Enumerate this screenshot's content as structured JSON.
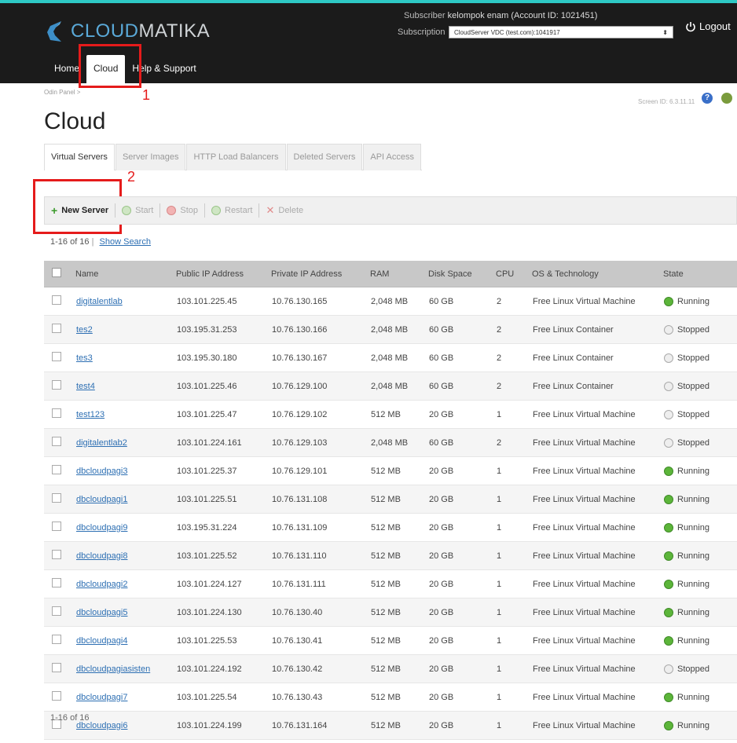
{
  "brand": {
    "part1": "CLOUD",
    "part2": "MATIKA"
  },
  "subscriber": {
    "label": "Subscriber",
    "value": "kelompok enam (Account ID: 1021451)"
  },
  "subscription": {
    "label": "Subscription",
    "value": "CloudServer VDC (test.com):1041917"
  },
  "logout": "Logout",
  "nav": [
    "Home",
    "Cloud",
    "Help & Support"
  ],
  "annotations": [
    "1",
    "2"
  ],
  "breadcrumb": "Odin Panel >",
  "screen_id": "Screen ID: 6.3.11.11",
  "help_glyph": "?",
  "page_title": "Cloud",
  "tabs": [
    "Virtual Servers",
    "Server Images",
    "HTTP Load Balancers",
    "Deleted Servers",
    "API Access"
  ],
  "toolbar": {
    "new": "New Server",
    "start": "Start",
    "stop": "Stop",
    "restart": "Restart",
    "delete": "Delete"
  },
  "count_top": {
    "text": "1-16 of 16",
    "link": "Show Search"
  },
  "columns": [
    "Name",
    "Public IP Address",
    "Private IP Address",
    "RAM",
    "Disk Space",
    "CPU",
    "OS & Technology",
    "State"
  ],
  "rows": [
    [
      "digitalentlab",
      "103.101.225.45",
      "10.76.130.165",
      "2,048 MB",
      "60 GB",
      "2",
      "Free Linux Virtual Machine",
      "Running"
    ],
    [
      "tes2",
      "103.195.31.253",
      "10.76.130.166",
      "2,048 MB",
      "60 GB",
      "2",
      "Free Linux Container",
      "Stopped"
    ],
    [
      "tes3",
      "103.195.30.180",
      "10.76.130.167",
      "2,048 MB",
      "60 GB",
      "2",
      "Free Linux Container",
      "Stopped"
    ],
    [
      "test4",
      "103.101.225.46",
      "10.76.129.100",
      "2,048 MB",
      "60 GB",
      "2",
      "Free Linux Container",
      "Stopped"
    ],
    [
      "test123",
      "103.101.225.47",
      "10.76.129.102",
      "512 MB",
      "20 GB",
      "1",
      "Free Linux Virtual Machine",
      "Stopped"
    ],
    [
      "digitalentlab2",
      "103.101.224.161",
      "10.76.129.103",
      "2,048 MB",
      "60 GB",
      "2",
      "Free Linux Virtual Machine",
      "Stopped"
    ],
    [
      "dbcloudpagi3",
      "103.101.225.37",
      "10.76.129.101",
      "512 MB",
      "20 GB",
      "1",
      "Free Linux Virtual Machine",
      "Running"
    ],
    [
      "dbcloudpagi1",
      "103.101.225.51",
      "10.76.131.108",
      "512 MB",
      "20 GB",
      "1",
      "Free Linux Virtual Machine",
      "Running"
    ],
    [
      "dbcloudpagi9",
      "103.195.31.224",
      "10.76.131.109",
      "512 MB",
      "20 GB",
      "1",
      "Free Linux Virtual Machine",
      "Running"
    ],
    [
      "dbcloudpagi8",
      "103.101.225.52",
      "10.76.131.110",
      "512 MB",
      "20 GB",
      "1",
      "Free Linux Virtual Machine",
      "Running"
    ],
    [
      "dbcloudpagi2",
      "103.101.224.127",
      "10.76.131.111",
      "512 MB",
      "20 GB",
      "1",
      "Free Linux Virtual Machine",
      "Running"
    ],
    [
      "dbcloudpagi5",
      "103.101.224.130",
      "10.76.130.40",
      "512 MB",
      "20 GB",
      "1",
      "Free Linux Virtual Machine",
      "Running"
    ],
    [
      "dbcloudpagi4",
      "103.101.225.53",
      "10.76.130.41",
      "512 MB",
      "20 GB",
      "1",
      "Free Linux Virtual Machine",
      "Running"
    ],
    [
      "dbcloudpagiasisten",
      "103.101.224.192",
      "10.76.130.42",
      "512 MB",
      "20 GB",
      "1",
      "Free Linux Virtual Machine",
      "Stopped"
    ],
    [
      "dbcloudpagi7",
      "103.101.225.54",
      "10.76.130.43",
      "512 MB",
      "20 GB",
      "1",
      "Free Linux Virtual Machine",
      "Running"
    ],
    [
      "dbcloudpagi6",
      "103.101.224.199",
      "10.76.131.164",
      "512 MB",
      "20 GB",
      "1",
      "Free Linux Virtual Machine",
      "Running"
    ]
  ],
  "count_bottom": "1-16 of 16",
  "colors": {
    "accent_teal": "#2ec9c5",
    "annotation_red": "#e51b1b",
    "link_blue": "#2d6fb3",
    "running_green": "#5cb53a"
  }
}
